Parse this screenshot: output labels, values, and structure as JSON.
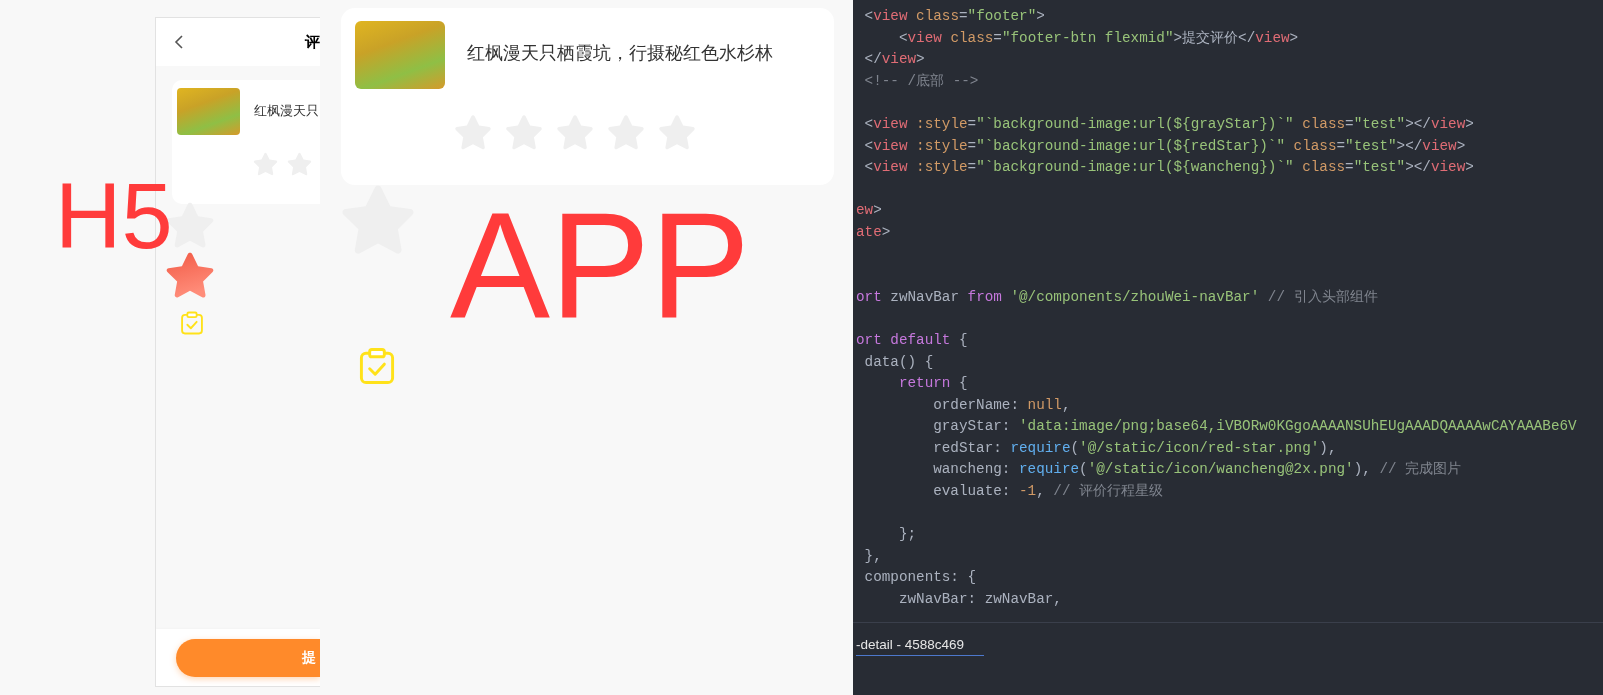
{
  "annotations": [
    {
      "text": "H5"
    },
    {
      "text": "APP"
    }
  ],
  "h5_preview": {
    "title": "评",
    "card": {
      "title": "红枫漫天只"
    },
    "test_images": [
      {
        "kind": "gray-star"
      },
      {
        "kind": "red-star"
      },
      {
        "kind": "clipboard"
      }
    ],
    "submit_button": "提"
  },
  "app_preview": {
    "card": {
      "title": "红枫漫天只栖霞坑，行摄秘红色水杉林"
    },
    "test_images": [
      {
        "kind": "gray-star"
      },
      {
        "kind": "clipboard"
      }
    ]
  },
  "editor": {
    "lines": [
      {
        "kind": "code",
        "tokens": [
          {
            "kind": "punct",
            "text": " <"
          },
          {
            "kind": "tag",
            "text": "view"
          },
          {
            "kind": "attr",
            "text": " class"
          },
          {
            "kind": "punct",
            "text": "="
          },
          {
            "kind": "string",
            "text": "\"footer\""
          },
          {
            "kind": "punct",
            "text": ">"
          }
        ]
      },
      {
        "kind": "code",
        "tokens": [
          {
            "kind": "punct",
            "text": "     <"
          },
          {
            "kind": "tag",
            "text": "view"
          },
          {
            "kind": "attr",
            "text": " class"
          },
          {
            "kind": "punct",
            "text": "="
          },
          {
            "kind": "string",
            "text": "\"footer-btn flexmid\""
          },
          {
            "kind": "punct",
            "text": ">提交评价</"
          },
          {
            "kind": "tag",
            "text": "view"
          },
          {
            "kind": "punct",
            "text": ">"
          }
        ]
      },
      {
        "kind": "code",
        "tokens": [
          {
            "kind": "punct",
            "text": " </"
          },
          {
            "kind": "tag",
            "text": "view"
          },
          {
            "kind": "punct",
            "text": ">"
          }
        ]
      },
      {
        "kind": "code",
        "tokens": [
          {
            "kind": "comment",
            "text": " <!-- /底部 -->"
          }
        ]
      },
      {
        "kind": "blank"
      },
      {
        "kind": "code",
        "tokens": [
          {
            "kind": "punct",
            "text": " <"
          },
          {
            "kind": "tag",
            "text": "view"
          },
          {
            "kind": "attr",
            "text": " :style"
          },
          {
            "kind": "punct",
            "text": "="
          },
          {
            "kind": "string",
            "text": "\"`background-image:url(${grayStar})`\""
          },
          {
            "kind": "attr",
            "text": " class"
          },
          {
            "kind": "punct",
            "text": "="
          },
          {
            "kind": "string",
            "text": "\"test\""
          },
          {
            "kind": "punct",
            "text": "></"
          },
          {
            "kind": "tag",
            "text": "view"
          },
          {
            "kind": "punct",
            "text": ">"
          }
        ]
      },
      {
        "kind": "code",
        "tokens": [
          {
            "kind": "punct",
            "text": " <"
          },
          {
            "kind": "tag",
            "text": "view"
          },
          {
            "kind": "attr",
            "text": " :style"
          },
          {
            "kind": "punct",
            "text": "="
          },
          {
            "kind": "string",
            "text": "\"`background-image:url(${redStar})`\""
          },
          {
            "kind": "attr",
            "text": " class"
          },
          {
            "kind": "punct",
            "text": "="
          },
          {
            "kind": "string",
            "text": "\"test\""
          },
          {
            "kind": "punct",
            "text": "></"
          },
          {
            "kind": "tag",
            "text": "view"
          },
          {
            "kind": "punct",
            "text": ">"
          }
        ]
      },
      {
        "kind": "code",
        "tokens": [
          {
            "kind": "punct",
            "text": " <"
          },
          {
            "kind": "tag",
            "text": "view"
          },
          {
            "kind": "attr",
            "text": " :style"
          },
          {
            "kind": "punct",
            "text": "="
          },
          {
            "kind": "string",
            "text": "\"`background-image:url(${wancheng})`\""
          },
          {
            "kind": "attr",
            "text": " class"
          },
          {
            "kind": "punct",
            "text": "="
          },
          {
            "kind": "string",
            "text": "\"test\""
          },
          {
            "kind": "punct",
            "text": "></"
          },
          {
            "kind": "tag",
            "text": "view"
          },
          {
            "kind": "punct",
            "text": ">"
          }
        ]
      },
      {
        "kind": "blank"
      },
      {
        "kind": "code",
        "tokens": [
          {
            "kind": "tag",
            "text": "ew"
          },
          {
            "kind": "punct",
            "text": ">"
          }
        ]
      },
      {
        "kind": "code",
        "tokens": [
          {
            "kind": "tag",
            "text": "ate"
          },
          {
            "kind": "punct",
            "text": ">"
          }
        ]
      },
      {
        "kind": "blank"
      },
      {
        "kind": "blank"
      },
      {
        "kind": "code",
        "tokens": [
          {
            "kind": "keyword",
            "text": "ort"
          },
          {
            "kind": "punct",
            "text": " zwNavBar "
          },
          {
            "kind": "keyword",
            "text": "from"
          },
          {
            "kind": "string",
            "text": " '@/components/zhouWei-navBar'"
          },
          {
            "kind": "comment",
            "text": " // 引入头部组件"
          }
        ]
      },
      {
        "kind": "blank"
      },
      {
        "kind": "code",
        "tokens": [
          {
            "kind": "keyword",
            "text": "ort"
          },
          {
            "kind": "keyword",
            "text": " default"
          },
          {
            "kind": "punct",
            "text": " {"
          }
        ]
      },
      {
        "kind": "code",
        "tokens": [
          {
            "kind": "punct",
            "text": " data() {"
          }
        ]
      },
      {
        "kind": "code",
        "tokens": [
          {
            "kind": "keyword",
            "text": "     return"
          },
          {
            "kind": "punct",
            "text": " {"
          }
        ]
      },
      {
        "kind": "code",
        "tokens": [
          {
            "kind": "punct",
            "text": "         orderName: "
          },
          {
            "kind": "number",
            "text": "null"
          },
          {
            "kind": "punct",
            "text": ","
          }
        ]
      },
      {
        "kind": "code",
        "tokens": [
          {
            "kind": "punct",
            "text": "         grayStar: "
          },
          {
            "kind": "string",
            "text": "'data:image/png;base64,iVBORw0KGgoAAAANSUhEUgAAADQAAAAwCAYAAABe6V"
          }
        ]
      },
      {
        "kind": "code",
        "tokens": [
          {
            "kind": "punct",
            "text": "         redStar: "
          },
          {
            "kind": "func",
            "text": "require"
          },
          {
            "kind": "punct",
            "text": "("
          },
          {
            "kind": "string",
            "text": "'@/static/icon/red-star.png'"
          },
          {
            "kind": "punct",
            "text": "),"
          }
        ]
      },
      {
        "kind": "code",
        "tokens": [
          {
            "kind": "punct",
            "text": "         wancheng: "
          },
          {
            "kind": "func",
            "text": "require"
          },
          {
            "kind": "punct",
            "text": "("
          },
          {
            "kind": "string",
            "text": "'@/static/icon/wancheng@2x.png'"
          },
          {
            "kind": "punct",
            "text": "), "
          },
          {
            "kind": "comment",
            "text": "// 完成图片"
          }
        ]
      },
      {
        "kind": "code",
        "tokens": [
          {
            "kind": "punct",
            "text": "         evaluate: "
          },
          {
            "kind": "number",
            "text": "-1"
          },
          {
            "kind": "punct",
            "text": ", "
          },
          {
            "kind": "comment",
            "text": "// 评价行程星级"
          }
        ]
      },
      {
        "kind": "blank"
      },
      {
        "kind": "code",
        "tokens": [
          {
            "kind": "punct",
            "text": "     };"
          }
        ]
      },
      {
        "kind": "code",
        "tokens": [
          {
            "kind": "punct",
            "text": " },"
          }
        ]
      },
      {
        "kind": "code",
        "tokens": [
          {
            "kind": "punct",
            "text": " components: {"
          }
        ]
      },
      {
        "kind": "code",
        "tokens": [
          {
            "kind": "punct",
            "text": "     zwNavBar: zwNavBar,"
          }
        ]
      }
    ],
    "panel_tab": {
      "label": "-detail - 4588c469",
      "selected": true
    }
  }
}
